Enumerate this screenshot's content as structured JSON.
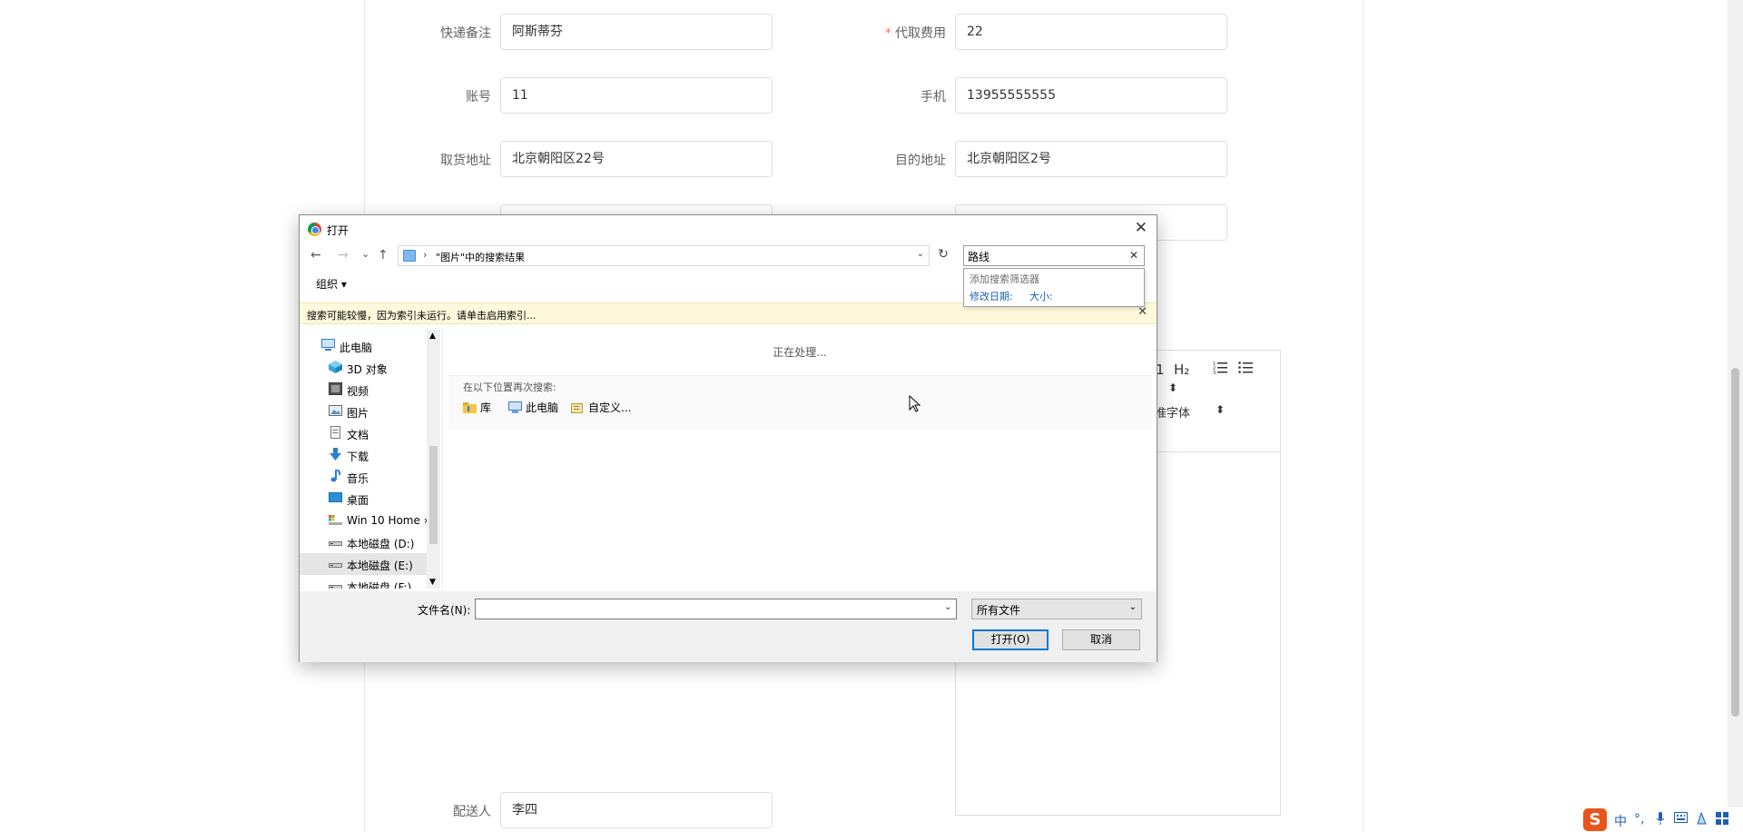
{
  "form": {
    "express_note_label": "快递备注",
    "express_note_value": "阿斯蒂芬",
    "fee_required_mark": "*",
    "fee_label": "代取费用",
    "fee_value": "22",
    "account_label": "账号",
    "account_value": "11",
    "phone_label": "手机",
    "phone_value": "13955555555",
    "pickup_label": "取货地址",
    "pickup_value": "北京朝阳区22号",
    "dest_label": "目的地址",
    "dest_value": "北京朝阳区2号",
    "courier_label": "配送人",
    "courier_value": "李四"
  },
  "editor": {
    "h1": "1",
    "h2": "H₂",
    "ol_icon": "ordered-list-icon",
    "ul_icon": "unordered-list-icon",
    "size_arrows": "⬍",
    "font_label": "准字体",
    "font_arrows": "⬍"
  },
  "dialog": {
    "title": "打开",
    "close": "✕",
    "nav_back": "←",
    "nav_forward": "→",
    "nav_recent": "⌄",
    "nav_up": "↑",
    "breadcrumb_sep": "›",
    "breadcrumb": "\"图片\"中的搜索结果",
    "address_dropdown": "⌄",
    "refresh": "↻",
    "search_value": "路线",
    "search_clear": "✕",
    "search_hint": "添加搜索筛选器",
    "filter_date": "修改日期:",
    "filter_size": "大小:",
    "organize": "组织 ▾",
    "warning": "搜索可能较慢，因为索引未运行。请单击启用索引...",
    "warning_close": "✕",
    "tree": [
      {
        "label": "此电脑",
        "icon": "computer-icon"
      },
      {
        "label": "3D 对象",
        "icon": "3d-objects-icon"
      },
      {
        "label": "视频",
        "icon": "video-icon"
      },
      {
        "label": "图片",
        "icon": "pictures-icon"
      },
      {
        "label": "文档",
        "icon": "documents-icon"
      },
      {
        "label": "下载",
        "icon": "download-icon"
      },
      {
        "label": "音乐",
        "icon": "music-icon"
      },
      {
        "label": "桌面",
        "icon": "desktop-icon"
      },
      {
        "label": "Win 10 Home ›",
        "icon": "drive-c-icon"
      },
      {
        "label": "本地磁盘 (D:)",
        "icon": "drive-icon"
      },
      {
        "label": "本地磁盘 (E:)",
        "icon": "drive-icon"
      },
      {
        "label": "本地磁盘 (F:)",
        "icon": "drive-icon"
      }
    ],
    "processing": "正在处理...",
    "search_again": "在以下位置再次搜索:",
    "locations": [
      {
        "label": "库",
        "icon": "library-icon"
      },
      {
        "label": "此电脑",
        "icon": "computer-icon"
      },
      {
        "label": "自定义...",
        "icon": "custom-folder-icon"
      }
    ],
    "filename_label": "文件名(N):",
    "filename_value": "",
    "filename_dropdown": "⌄",
    "filetype_value": "所有文件",
    "filetype_dropdown": "⌄",
    "open_button": "打开(O)",
    "cancel_button": "取消"
  },
  "ime": {
    "logo": "S",
    "mode": "中",
    "punct": "°,",
    "mic": "🎤"
  },
  "colors": {
    "accent_blue": "#0078d7",
    "required_red": "#f56c6c",
    "ime_orange": "#e9541d",
    "warning_bg": "#fff9dc"
  }
}
